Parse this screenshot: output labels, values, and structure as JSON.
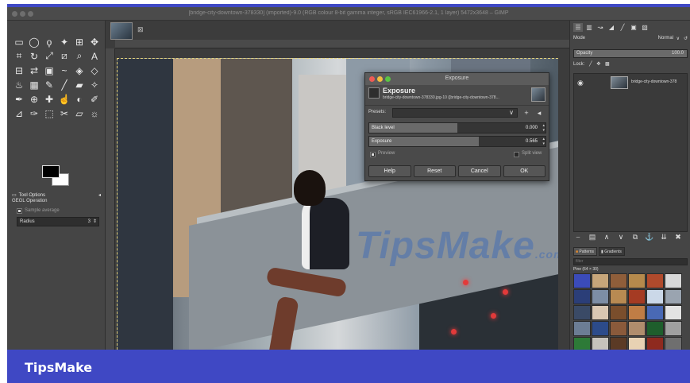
{
  "window": {
    "title": "[bridge-city-downtown-378330] (imported)-9.0 (RGB colour 8-bit gamma integer, sRGB IEC61966-2.1, 1 layer) 5472x3648 – GIMP"
  },
  "toolbox": {
    "tools": [
      "rect-select-icon",
      "ellipse-select-icon",
      "lasso-icon",
      "fuzzy-select-icon",
      "by-color-select-icon",
      "move-icon",
      "crop-icon",
      "rotate-icon",
      "scale-icon",
      "shear-icon",
      "zoom-icon",
      "text-icon",
      "align-icon",
      "flip-icon",
      "cage-icon",
      "warp-icon",
      "unified-transform-icon",
      "handle-transform-icon",
      "paint-bucket-icon",
      "gradient-icon",
      "pencil-icon",
      "paintbrush-icon",
      "eraser-icon",
      "airbrush-icon",
      "ink-icon",
      "clone-icon",
      "heal-icon",
      "smudge-icon",
      "dodge-icon",
      "color-picker-icon",
      "measure-icon",
      "paths-icon",
      "foreground-select-icon",
      "scissors-icon",
      "perspective-icon",
      "transform-3d-icon"
    ],
    "tool_glyphs": [
      "▭",
      "◯",
      "ϙ",
      "✦",
      "⊞",
      "✥",
      "⌗",
      "↻",
      "⤢",
      "⧄",
      "⌕",
      "A",
      "⊟",
      "⇄",
      "▣",
      "~",
      "◈",
      "◇",
      "♨",
      "▦",
      "✎",
      "╱",
      "▰",
      "✧",
      "✒",
      "⊕",
      "✚",
      "☝",
      "◐",
      "✐",
      "⊿",
      "✑",
      "⬚",
      "✂",
      "▱",
      "☼"
    ],
    "tool_options_label": "Tool Options",
    "operation_label": "GEGL Operation",
    "sample_average_label": "Sample average",
    "radius_label": "Radius",
    "radius_value": "3"
  },
  "dialog": {
    "window_title": "Exposure",
    "name": "Exposure",
    "subtitle": "bridge-city-downtown-378330.jpg-10 ([bridge-city-downtown-378...",
    "presets_label": "Presets:",
    "presets_value": "",
    "black_level_label": "Black level",
    "black_level_value": "0.000",
    "black_level_fraction": 0.5,
    "exposure_label": "Exposure",
    "exposure_value": "0.565",
    "exposure_fraction": 0.62,
    "preview_label": "Preview",
    "split_view_label": "Split view",
    "buttons": {
      "help": "Help",
      "reset": "Reset",
      "cancel": "Cancel",
      "ok": "OK"
    }
  },
  "dock": {
    "mode_label": "Mode",
    "mode_value": "Normal",
    "opacity_label": "Opacity",
    "opacity_value": "100.0",
    "lock_label": "Lock:",
    "layer_name": "bridge-city-downtown-378",
    "patterns_tab": "Patterns",
    "gradients_tab": "Gradients",
    "filter_placeholder": "filter",
    "pattern_name": "Pine (64 × 30)",
    "swatches": [
      "#3b4bb8",
      "#c7a67a",
      "#8f5e3a",
      "#b58a4c",
      "#b04a2c",
      "#d8d8d8",
      "#2b3e78",
      "#7d8ea5",
      "#b88a52",
      "#a53b23",
      "#cbd8e8",
      "#9aa4b0",
      "#3a4a66",
      "#d9c7b2",
      "#7a4e2c",
      "#c07d45",
      "#4969b5",
      "#e3e3e3",
      "#6c7d94",
      "#2c4b8a",
      "#8a5a3b",
      "#b08d6d",
      "#1e5e2c",
      "#a0a0a0",
      "#2d7a37",
      "#c6c2bc",
      "#5b3a25",
      "#e8d2b3",
      "#8e2a1f",
      "#6f6f6f",
      "#c28a50",
      "#87a9d3",
      "#d48c4a",
      "#b2b2b2",
      "#5f7c5d",
      "#efe4d1"
    ]
  },
  "canvas": {
    "watermark": "TipsMake",
    "watermark_suffix": ".com"
  },
  "brand": "TipsMake"
}
